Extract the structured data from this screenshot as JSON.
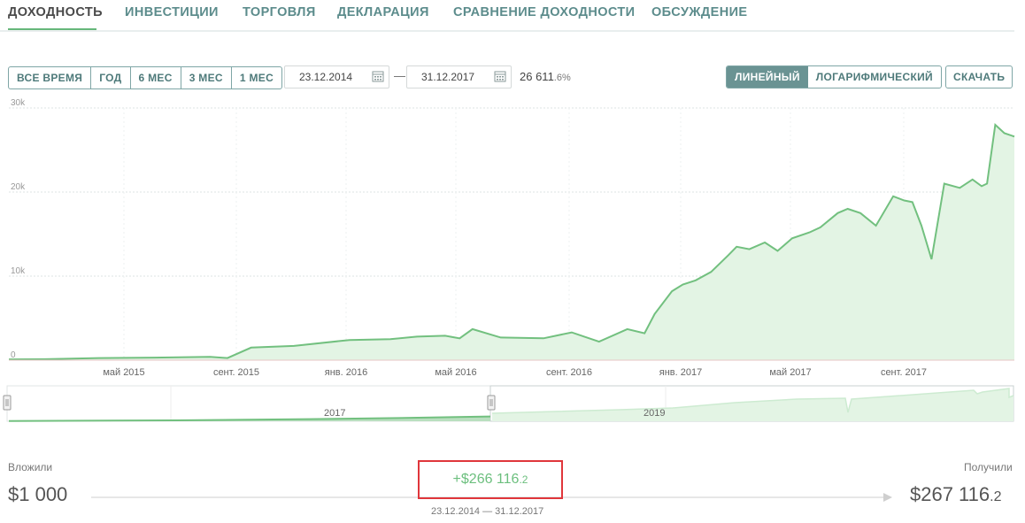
{
  "tabs": [
    {
      "label": "ДОХОДНОСТЬ",
      "active": true
    },
    {
      "label": "ИНВЕСТИЦИИ"
    },
    {
      "label": "ТОРГОВЛЯ"
    },
    {
      "label": "ДЕКЛАРАЦИЯ"
    },
    {
      "label": "СРАВНЕНИЕ ДОХОДНОСТИ"
    },
    {
      "label": "ОБСУЖДЕНИЕ"
    }
  ],
  "periods": [
    "ВСЕ ВРЕМЯ",
    "ГОД",
    "6 МЕС",
    "3 МЕС",
    "1 МЕС"
  ],
  "date_from": "23.12.2014",
  "date_separator": "—",
  "date_to": "31.12.2017",
  "return_pct_main": "26 611",
  "return_pct_dec": ".6%",
  "scale_options": [
    {
      "label": "ЛИНЕЙНЫЙ",
      "active": true
    },
    {
      "label": "ЛОГАРИФМИЧЕСКИЙ"
    }
  ],
  "download_label": "СКАЧАТЬ",
  "invested_label": "Вложили",
  "invested_value": "$1 000",
  "received_label": "Получили",
  "received_value_main": "$267 116",
  "received_value_dec": ".2",
  "gain_main": "+$266 116",
  "gain_dec": ".2",
  "gain_range": "23.12.2014 — 31.12.2017",
  "colors": {
    "accent": "#6cbf7e",
    "line": "#72c07f",
    "fill": "#e3f4e4",
    "highlight_border": "#e0363b"
  },
  "chart_data": {
    "type": "area",
    "y_ticks": [
      "0",
      "10k",
      "20k",
      "30k"
    ],
    "ylim": [
      0,
      30000
    ],
    "x_ticks": [
      "май 2015",
      "сент. 2015",
      "янв. 2016",
      "май 2016",
      "сент. 2016",
      "янв. 2017",
      "май 2017",
      "сент. 2017"
    ],
    "grid": true,
    "series": [
      {
        "x": [
          "2014-12-23",
          "2015-02-01",
          "2015-04-01",
          "2015-06-01",
          "2015-08-01",
          "2015-08-20",
          "2015-09-15",
          "2015-11-01",
          "2016-01-01",
          "2016-02-15",
          "2016-03-15",
          "2016-04-15",
          "2016-05-01",
          "2016-05-15",
          "2016-06-15",
          "2016-08-01",
          "2016-09-01",
          "2016-10-01",
          "2016-11-01",
          "2016-11-20",
          "2016-12-01",
          "2016-12-20",
          "2017-01-01",
          "2017-01-15",
          "2017-02-01",
          "2017-02-20",
          "2017-03-01",
          "2017-03-15",
          "2017-04-01",
          "2017-04-15",
          "2017-05-01",
          "2017-05-20",
          "2017-06-01",
          "2017-06-20",
          "2017-07-01",
          "2017-07-15",
          "2017-08-01",
          "2017-08-20",
          "2017-09-01",
          "2017-09-10",
          "2017-09-20",
          "2017-10-01",
          "2017-10-15",
          "2017-11-01",
          "2017-11-15",
          "2017-11-25",
          "2017-12-01",
          "2017-12-10",
          "2017-12-20",
          "2017-12-31"
        ],
        "y": [
          100,
          120,
          250,
          300,
          400,
          250,
          1500,
          1700,
          2400,
          2500,
          2800,
          2900,
          2600,
          3700,
          2700,
          2600,
          3300,
          2200,
          3700,
          3200,
          5500,
          8200,
          9000,
          9500,
          10500,
          12500,
          13500,
          13200,
          14000,
          13000,
          14500,
          15200,
          15800,
          17500,
          18000,
          17500,
          16000,
          19500,
          19000,
          18800,
          16000,
          12000,
          21000,
          20500,
          21500,
          20700,
          21000,
          28000,
          27000,
          26600
        ]
      }
    ]
  }
}
